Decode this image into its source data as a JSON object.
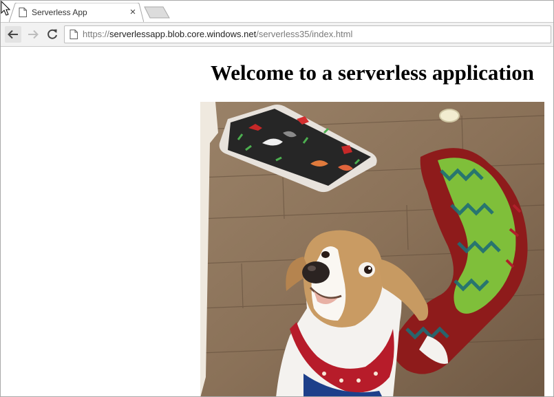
{
  "browser": {
    "tab_title": "Serverless App",
    "tab_close_glyph": "×",
    "address_bar": {
      "scheme": "https://",
      "host": "serverlessapp.blob.core.windows.net",
      "path": "/serverless35/index.html"
    },
    "icons": {
      "favicon": "page-icon",
      "back": "arrow-left-icon",
      "forward": "arrow-right-icon",
      "reload": "reload-icon",
      "omnibox": "page-icon",
      "new_tab": "new-tab-icon",
      "cursor": "mouse-pointer-icon"
    }
  },
  "page": {
    "heading": "Welcome to a serverless application",
    "image_subject": "dog-photo"
  }
}
